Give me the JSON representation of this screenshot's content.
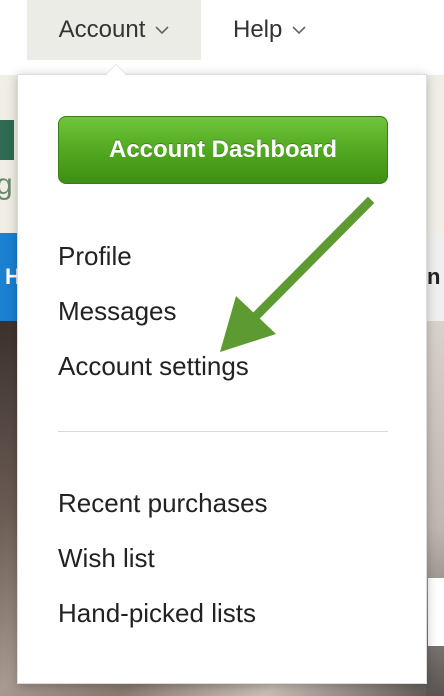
{
  "nav": {
    "account_label": "Account",
    "help_label": "Help"
  },
  "dropdown": {
    "dashboard_button": "Account Dashboard",
    "primary_items": [
      "Profile",
      "Messages",
      "Account settings"
    ],
    "secondary_items": [
      "Recent purchases",
      "Wish list",
      "Hand-picked lists"
    ]
  },
  "background": {
    "logo_letter": "g",
    "left_tab_letter": "H",
    "right_tab_letter": "n"
  },
  "colors": {
    "button_green": "#4fa61f",
    "annotation_arrow": "#5e9a32",
    "blue_band": "#1b80d0",
    "beige_band": "#f1efe5"
  }
}
